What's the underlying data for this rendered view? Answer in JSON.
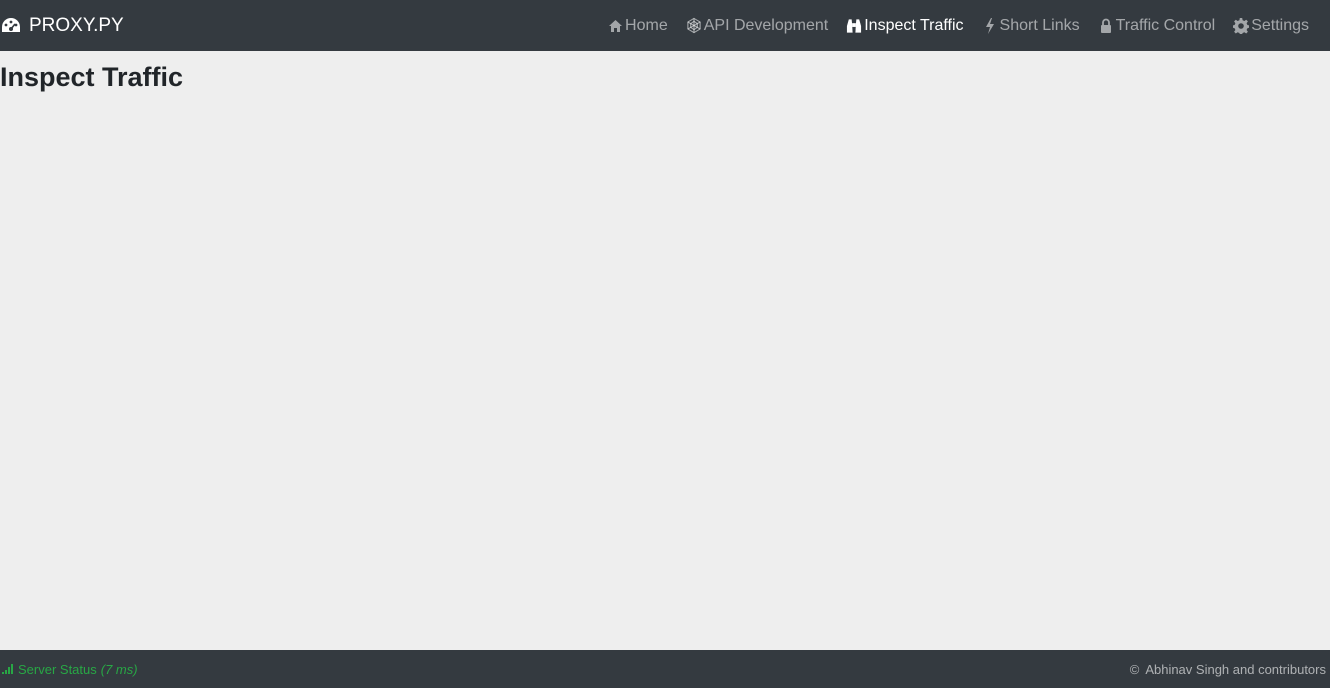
{
  "brand": {
    "name": "PROXY.PY",
    "icon": "tachometer-icon"
  },
  "nav": {
    "items": [
      {
        "label": "Home",
        "icon": "home-icon"
      },
      {
        "label": "API Development",
        "icon": "connectdevelop-icon"
      },
      {
        "label": "Inspect Traffic",
        "icon": "binoculars-icon",
        "active": true
      },
      {
        "label": "Short Links",
        "icon": "bolt-icon"
      },
      {
        "label": "Traffic Control",
        "icon": "lock-icon"
      },
      {
        "label": "Settings",
        "icon": "gear-icon"
      }
    ]
  },
  "main": {
    "title": "Inspect Traffic"
  },
  "footer": {
    "status_label": "Server Status",
    "status_latency": "(7 ms)",
    "copyright_symbol": "©",
    "copyright_text": "Abhinav Singh and contributors"
  },
  "colors": {
    "navbar_bg": "#343a40",
    "page_bg": "#eeeeee",
    "status_green": "#28a745",
    "active_nav": "#ffffff"
  }
}
